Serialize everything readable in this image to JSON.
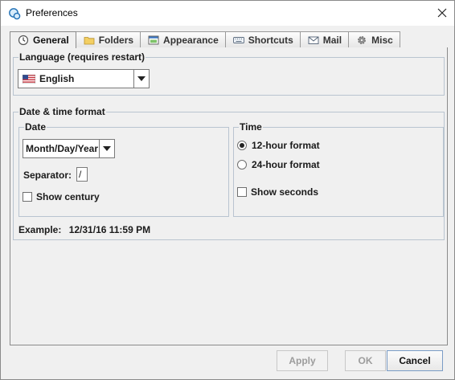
{
  "window": {
    "title": "Preferences"
  },
  "tabs": [
    {
      "label": "General",
      "icon": "clock-icon",
      "active": true
    },
    {
      "label": "Folders",
      "icon": "folder-icon"
    },
    {
      "label": "Appearance",
      "icon": "appearance-icon"
    },
    {
      "label": "Shortcuts",
      "icon": "keyboard-icon"
    },
    {
      "label": "Mail",
      "icon": "mail-icon"
    },
    {
      "label": "Misc",
      "icon": "gear-icon"
    }
  ],
  "language": {
    "group_label": "Language (requires restart)",
    "selected": "English",
    "flag_icon": "us-flag-icon"
  },
  "datetime": {
    "group_label": "Date & time format",
    "date": {
      "group_label": "Date",
      "format_selected": "Month/Day/Year",
      "separator_label": "Separator:",
      "separator_value": "/",
      "show_century_label": "Show century",
      "show_century_checked": false
    },
    "time": {
      "group_label": "Time",
      "options": [
        {
          "label": "12-hour format",
          "checked": true
        },
        {
          "label": "24-hour format",
          "checked": false
        }
      ],
      "show_seconds_label": "Show seconds",
      "show_seconds_checked": false
    },
    "example_label": "Example:",
    "example_value": "12/31/16 11:59 PM"
  },
  "buttons": {
    "apply": "Apply",
    "ok": "OK",
    "cancel": "Cancel"
  }
}
